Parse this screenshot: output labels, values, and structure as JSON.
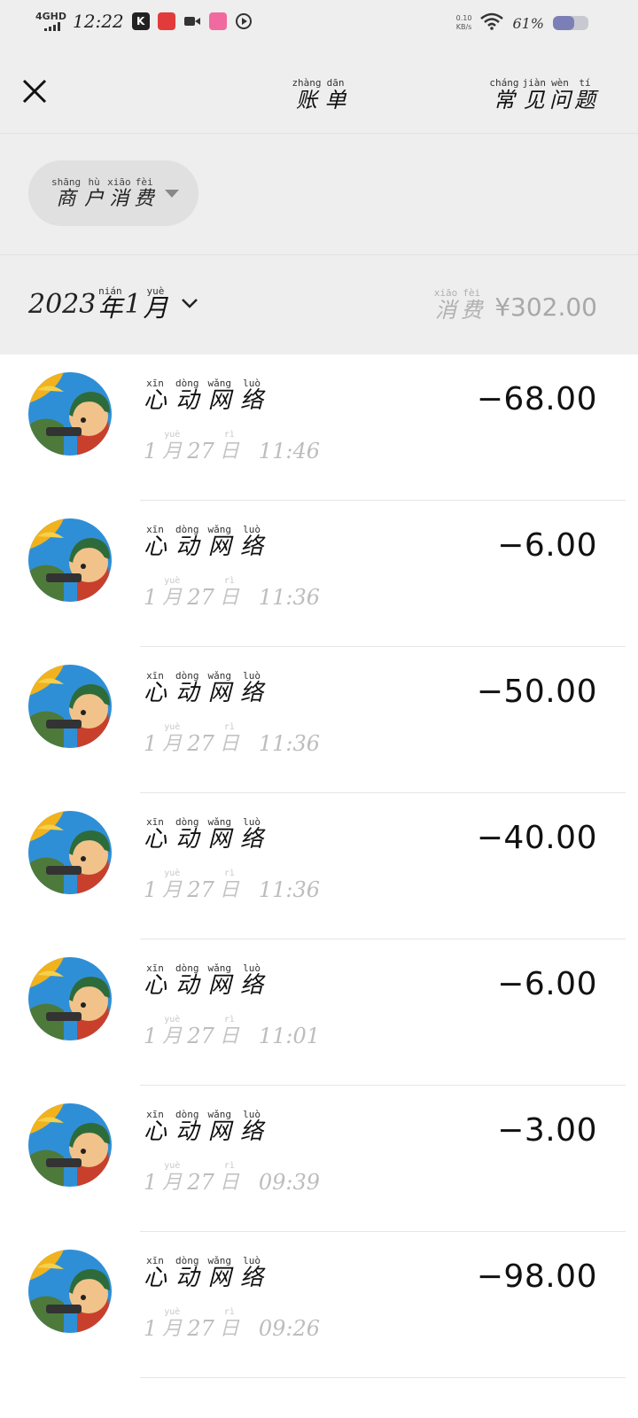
{
  "status_bar": {
    "network": "4GHD",
    "time": "12:22",
    "net_speed_value": "0.10",
    "net_speed_unit": "KB/s",
    "battery_text": "61%",
    "battery_level": 0.61,
    "app_icons": [
      "k-app-icon",
      "red-app-icon",
      "video-icon",
      "pink-app-icon",
      "play-icon"
    ]
  },
  "header": {
    "title": [
      {
        "py": "zhàng",
        "hz": "账"
      },
      {
        "py": "dān",
        "hz": "单"
      }
    ],
    "faq": [
      {
        "py": "cháng",
        "hz": "常"
      },
      {
        "py": "jiàn",
        "hz": "见"
      },
      {
        "py": "wèn",
        "hz": "问"
      },
      {
        "py": "tí",
        "hz": "题"
      }
    ]
  },
  "filter": {
    "label": [
      {
        "py": "shāng",
        "hz": "商"
      },
      {
        "py": "hù",
        "hz": "户"
      },
      {
        "py": "xiāo",
        "hz": "消"
      },
      {
        "py": "fèi",
        "hz": "费"
      }
    ]
  },
  "month": {
    "year": "2023",
    "year_char": {
      "py": "nián",
      "hz": "年"
    },
    "month_num": "1",
    "month_char": {
      "py": "yuè",
      "hz": "月"
    }
  },
  "summary": {
    "label": [
      {
        "py": "xiāo",
        "hz": "消"
      },
      {
        "py": "fèi",
        "hz": "费"
      }
    ],
    "amount": "¥302.00"
  },
  "merchant_name": [
    {
      "py": "xīn",
      "hz": "心"
    },
    {
      "py": "dòng",
      "hz": "动"
    },
    {
      "py": "wǎng",
      "hz": "网"
    },
    {
      "py": "luò",
      "hz": "络"
    }
  ],
  "transactions": [
    {
      "month": "1",
      "day": "27",
      "time": "11:46",
      "amount": "−68.00"
    },
    {
      "month": "1",
      "day": "27",
      "time": "11:36",
      "amount": "−6.00"
    },
    {
      "month": "1",
      "day": "27",
      "time": "11:36",
      "amount": "−50.00"
    },
    {
      "month": "1",
      "day": "27",
      "time": "11:36",
      "amount": "−40.00"
    },
    {
      "month": "1",
      "day": "27",
      "time": "11:01",
      "amount": "−6.00"
    },
    {
      "month": "1",
      "day": "27",
      "time": "09:39",
      "amount": "−3.00"
    },
    {
      "month": "1",
      "day": "27",
      "time": "09:26",
      "amount": "−98.00"
    }
  ],
  "date_chars": {
    "month": {
      "py": "yuè",
      "hz": "月"
    },
    "day": {
      "py": "rì",
      "hz": "日"
    }
  }
}
